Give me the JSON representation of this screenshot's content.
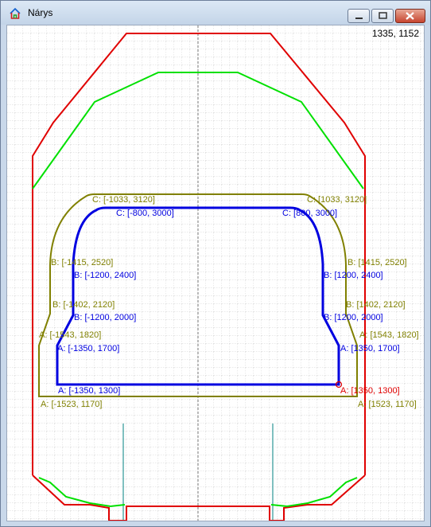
{
  "window": {
    "title": "Nárys",
    "coords": "1335, 1152"
  },
  "colors": {
    "outer": "#e00000",
    "green": "#00e000",
    "olive": "#808000",
    "blue": "#0000e0",
    "axis": "#606060",
    "teal": "#008080"
  },
  "labels": {
    "olive": {
      "c_left": "C: [-1033, 3120]",
      "c_right": "C: [1033, 3120]",
      "b1_left": "B: [-1415, 2520]",
      "b1_right": "B: [1415, 2520]",
      "b2_left": "B: [-1402, 2120]",
      "b2_right": "B: [1402, 2120]",
      "a1_left": "A: [-1543, 1820]",
      "a1_right": "A: [1543, 1820]",
      "a2_left": "A: [-1523, 1170]",
      "a2_right": "A: [1523, 1170]"
    },
    "blue": {
      "c_left": "C: [-800, 3000]",
      "c_right": "C: [800, 3000]",
      "b1_left": "B: [-1200, 2400]",
      "b1_right": "B: [1200, 2400]",
      "b2_left": "B: [-1200, 2000]",
      "b2_right": "B: [1200, 2000]",
      "a1_left": "A: [-1350, 1700]",
      "a1_right": "A: [1350, 1700]",
      "a2_left": "A: [-1350, 1300]"
    },
    "red": {
      "a2_right": "A: [1350, 1300]"
    }
  }
}
